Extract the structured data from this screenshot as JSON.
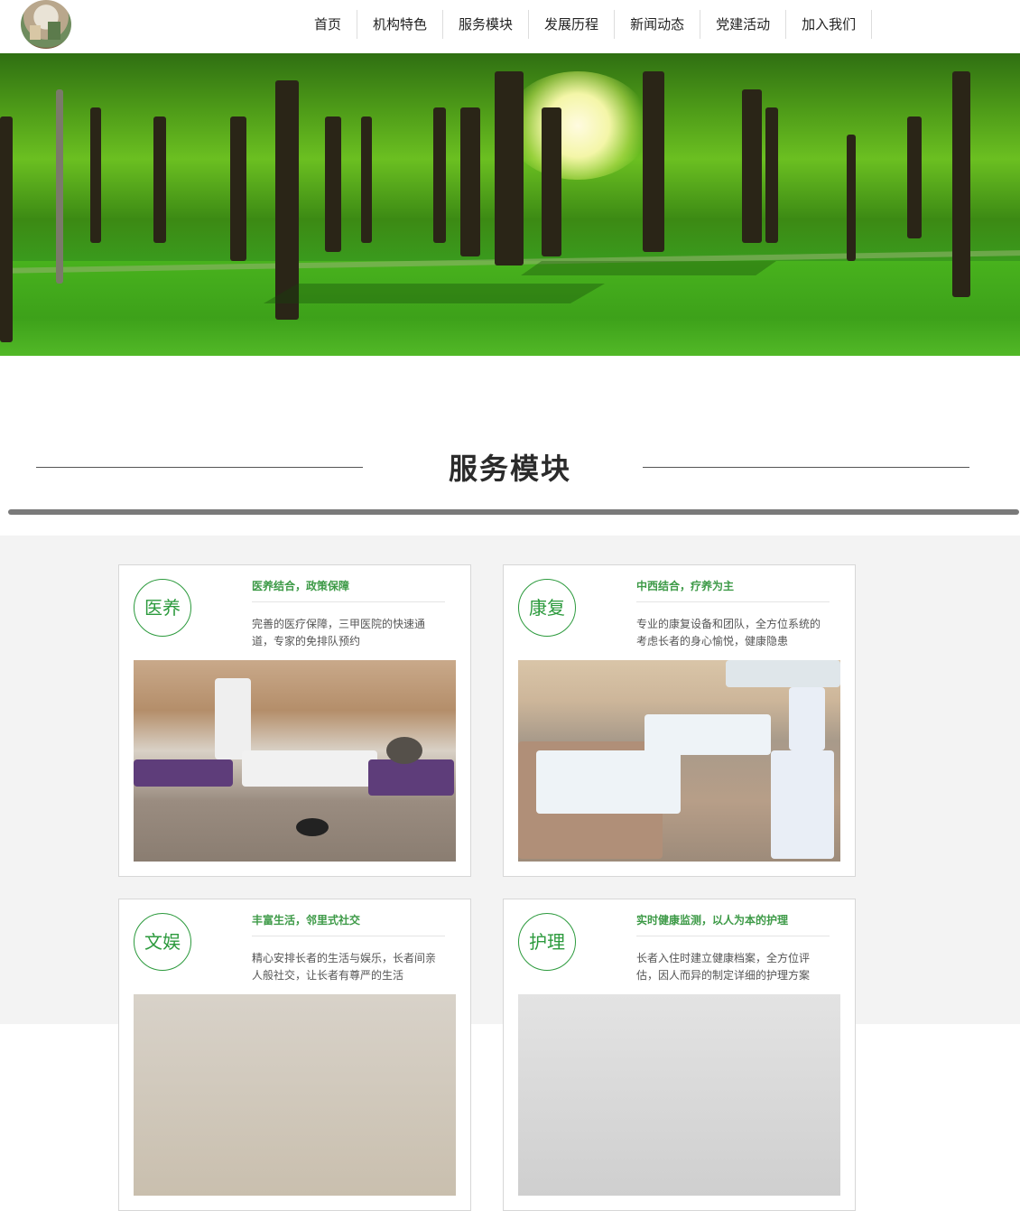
{
  "nav": {
    "items": [
      "首页",
      "机构特色",
      "服务模块",
      "发展历程",
      "新闻动态",
      "党建活动",
      "加入我们"
    ]
  },
  "section": {
    "title": "服务模块"
  },
  "cards": [
    {
      "badge": "医养",
      "headline": "医养结合，政策保障",
      "desc": "完善的医疗保障，三甲医院的快速通道，专家的免排队预约"
    },
    {
      "badge": "康复",
      "headline": "中西结合，疗养为主",
      "desc": "专业的康复设备和团队，全方位系统的考虑长者的身心愉悦，健康隐患"
    },
    {
      "badge": "文娱",
      "headline": "丰富生活，邻里式社交",
      "desc": "精心安排长者的生活与娱乐，长者间亲人般社交，让长者有尊严的生活"
    },
    {
      "badge": "护理",
      "headline": "实时健康监测，以人为本的护理",
      "desc": "长者入住时建立健康档案，全方位评估，因人而异的制定详细的护理方案"
    }
  ],
  "colors": {
    "accent": "#2c9a3d",
    "background": "#f3f3f3"
  }
}
